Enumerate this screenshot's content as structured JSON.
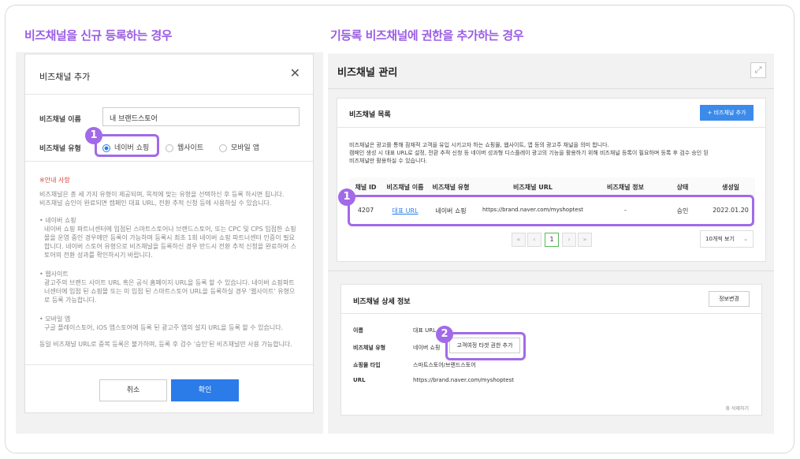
{
  "left": {
    "section_title": "비즈채널을 신규 등록하는 경우",
    "modal": {
      "title": "비즈채널 추가",
      "close_icon": "close-icon",
      "name_label": "비즈채널 이름",
      "name_value": "내 브랜드스토어",
      "type_label": "비즈채널 유형",
      "types": [
        "네이버 쇼핑",
        "웹사이트",
        "모바일 앱"
      ],
      "selected_type": "네이버 쇼핑",
      "notice_title": "※안내 사항",
      "notice_intro": "비즈채널은 총 세 가지 유형이 제공되며, 목적에 맞는 유형을 선택하신 후 등록 하시면 됩니다.\n비즈채널 승인이 완료되면 캠페인 대표 URL, 전환 추적 신청 등에 사용하실 수 있습니다.",
      "notice_items": [
        {
          "title": "네이버 쇼핑",
          "body": "네이버 쇼핑 파트너센터에 입점된 스마트스토어나 브랜드스토어, 또는 CPC 및 CPS 입점한 쇼핑몰을 운영 중인 경우에만 등록이 가능하며 등록시 최초 1회 네이버 쇼핑 파트너센터 인증이 필요합니다. 네이버 스토어 유형으로 비즈채널을 등록하신 경우 반드시 전환 추적 신청을 완료하여 스토어의 전환 성과를 확인하시기 바랍니다."
        },
        {
          "title": "웹사이트",
          "body": "광고주의 브랜드 사이트 URL 혹은 공식 홈페이지 URL을 등록 할 수 있습니다. 네이버 쇼핑파트너센터에 입점 된 쇼핑몰 또는 미 입점 된 스마트스토어 URL을 등록하실 경우 '웹사이트' 유형으로 등록 가능합니다."
        },
        {
          "title": "모바일 앱",
          "body": "구글 플레이스토어, iOS 앱스토어에 등록 된 광고주 앱의 설치 URL을 등록 할 수 있습니다."
        }
      ],
      "notice_footer": "동일 비즈채널 URL로 중복 등록은 불가하며, 등록 후 검수 '승인'된 비즈채널만 사용 가능합니다.",
      "cancel_label": "취소",
      "confirm_label": "확인"
    },
    "badge": "1"
  },
  "right": {
    "section_title": "기등록 비즈채널에 권한을 추가하는 경우",
    "manage_title": "비즈채널 관리",
    "expand_icon": "expand-icon",
    "list": {
      "title": "비즈채널 목록",
      "add_button": "+ 비즈채널 추가",
      "desc": "비즈채널은 광고를 통해 잠재적 고객을 유입 시키고자 하는 쇼핑몰, 웹사이트, 앱 등의 광고주 채널을 의미 합니다.\n캠페인 생성 시 대표 URL로 설정, 전환 추적 신청 등 네이버 성과형 디스플레이 광고의 기능을 활용하기 위해 비즈채널 등록이 필요하며 등록 후 검수 승인 된\n비즈채널만 활용하실 수 있습니다.",
      "columns": [
        "채널 ID",
        "비즈채널 이름",
        "비즈채널 유형",
        "비즈채널 URL",
        "비즈채널 정보",
        "상태",
        "생성일"
      ],
      "row": [
        "4207",
        "대표 URL",
        "네이버 쇼핑",
        "https://brand.naver.com/myshoptest",
        "-",
        "승인",
        "2022.01.20"
      ],
      "page": "1",
      "page_size": "10개씩 보기",
      "badge": "1"
    },
    "detail": {
      "title": "비즈채널 상세 정보",
      "edit_button": "정보변경",
      "fields": [
        {
          "label": "이름",
          "value": "대표 URL"
        },
        {
          "label": "비즈채널 유형",
          "value": "네이버 쇼핑"
        },
        {
          "label": "쇼핑몰 타입",
          "value": "스마트스토어/브랜드스토어"
        },
        {
          "label": "URL",
          "value": "https://brand.naver.com/myshoptest"
        }
      ],
      "retarget_button": "고객여정 타겟 권한 추가",
      "delete_label": "휴 삭제하기",
      "badge": "2"
    }
  }
}
